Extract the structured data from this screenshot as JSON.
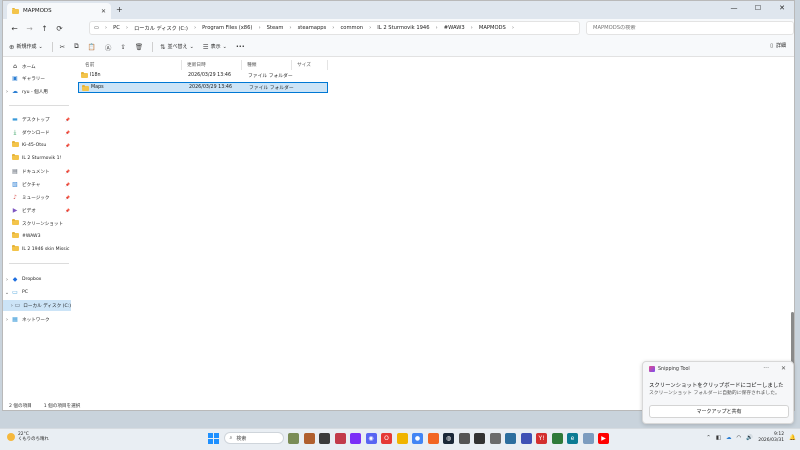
{
  "window": {
    "tab_title": "MAPMODS",
    "controls": [
      "—",
      "☐",
      "✕"
    ]
  },
  "address": {
    "crumbs": [
      "PC",
      "ローカル ディスク (C:)",
      "Program Files (x86)",
      "Steam",
      "steamapps",
      "common",
      "IL 2 Sturmovik 1946",
      "#WAW3",
      "MAPMODS"
    ],
    "search_placeholder": "MAPMODSの検索"
  },
  "commandbar": {
    "new_label": "新規作成",
    "sort_label": "並べ替え",
    "view_label": "表示",
    "more_label": "•••",
    "details_label": "詳細"
  },
  "navpane": {
    "home": "ホーム",
    "gallery": "ギャラリー",
    "personal": "ryu - 個人用",
    "quick": [
      {
        "label": "デスクトップ",
        "icon": "desktop-icon"
      },
      {
        "label": "ダウンロード",
        "icon": "download-icon"
      },
      {
        "label": "Ki-45-Otsu",
        "icon": "folder-icon"
      },
      {
        "label": "IL 2 Sturmovik 1!",
        "icon": "folder-icon"
      },
      {
        "label": "ドキュメント",
        "icon": "document-icon"
      },
      {
        "label": "ピクチャ",
        "icon": "pictures-icon"
      },
      {
        "label": "ミュージック",
        "icon": "music-icon"
      },
      {
        "label": "ビデオ",
        "icon": "video-icon"
      },
      {
        "label": "スクリーンショット",
        "icon": "folder-icon"
      },
      {
        "label": "#WAW3",
        "icon": "folder-icon"
      },
      {
        "label": "IL 2 1946 skin Missic",
        "icon": "folder-icon"
      }
    ],
    "dropbox": "Dropbox",
    "pc": "PC",
    "local_disk": "ローカル ディスク (C:)",
    "network": "ネットワーク"
  },
  "filelist": {
    "columns": [
      "名前",
      "更新日時",
      "種類",
      "サイズ"
    ],
    "rows": [
      {
        "name": "I18n",
        "modified": "2026/03/29 13:46",
        "type": "ファイル フォルダー",
        "size": ""
      },
      {
        "name": "Maps",
        "modified": "2026/03/29 13:46",
        "type": "ファイル フォルダー",
        "size": ""
      }
    ]
  },
  "status": {
    "item_count": "2 個の項目",
    "selection": "1 個の項目を選択"
  },
  "toast": {
    "app": "Snipping Tool",
    "title": "スクリーンショットをクリップボードにコピーしました",
    "body": "スクリーンショット フォルダーに自動的に保存されました。",
    "button": "マークアップと共有"
  },
  "taskbar": {
    "temperature": "22°C",
    "weather": "くもりのち晴れ",
    "search_label": "検索",
    "time": "9:12",
    "date": "2026/03/31"
  },
  "colors": {
    "accent": "#0078d4",
    "selection": "#cce4f7",
    "folder": "#f3c44b"
  }
}
